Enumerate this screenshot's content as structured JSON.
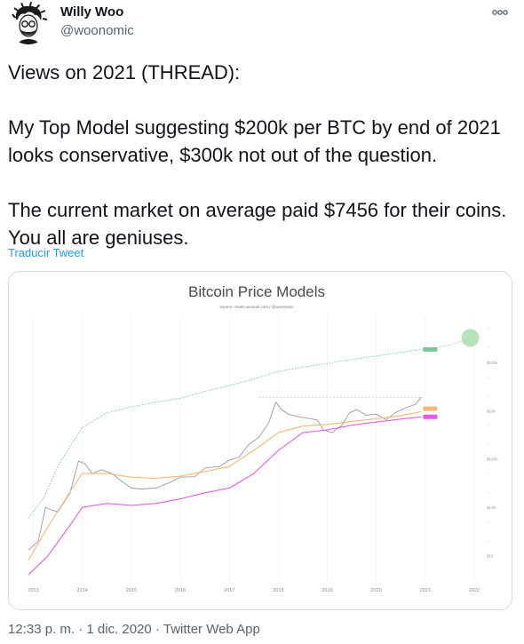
{
  "author": {
    "name": "Willy Woo",
    "handle": "@woonomic",
    "avatar_icon": "avatar-sketch"
  },
  "menu": {
    "more_icon": "more-dots-icon"
  },
  "tweet": {
    "paragraphs": [
      "Views on 2021 (THREAD):",
      "My Top Model suggesting $200k per BTC by end of 2021 looks conservative, $300k not out of the question.",
      "The current market on average paid $7456 for their coins. You all are geniuses."
    ],
    "translate_label": "Traducir Tweet"
  },
  "footer": {
    "time": "12:33 p. m.",
    "separator": "·",
    "date": "1 dic. 2020",
    "app": "Twitter Web App"
  },
  "colors": {
    "link": "#1d9bf0",
    "price": "#9a9a9a",
    "top_model": "#78c69a",
    "orange_model": "#f5b77a",
    "realized_price": "#e35ee8",
    "projection": "#9fd9a0"
  },
  "chart_data": {
    "type": "line",
    "title": "Bitcoin Price Models",
    "subtitle": "source: charts.woobull.com / @woonomic",
    "y_scale": "log",
    "x_ticks": [
      "2013",
      "2014",
      "2015",
      "2016",
      "2017",
      "2018",
      "2019",
      "2020",
      "2021",
      "2022"
    ],
    "y_ticks": [
      {
        "label": "$10",
        "value": 10
      },
      {
        "label": "$100",
        "value": 100
      },
      {
        "label": "$1000",
        "value": 1000
      },
      {
        "label": "$10k",
        "value": 10000
      },
      {
        "label": "$100k",
        "value": 100000
      }
    ],
    "xlim": [
      2012.9,
      2022.2
    ],
    "ylim": [
      3,
      900000
    ],
    "series": [
      {
        "key": "price",
        "x": [
          2012.9,
          2013.1,
          2013.25,
          2013.35,
          2013.5,
          2013.75,
          2013.92,
          2014.05,
          2014.2,
          2014.4,
          2014.6,
          2014.8,
          2015.0,
          2015.2,
          2015.5,
          2015.8,
          2016.0,
          2016.3,
          2016.5,
          2016.8,
          2017.0,
          2017.2,
          2017.4,
          2017.6,
          2017.8,
          2017.95,
          2018.05,
          2018.2,
          2018.4,
          2018.6,
          2018.8,
          2018.92,
          2019.1,
          2019.3,
          2019.45,
          2019.6,
          2019.8,
          2020.0,
          2020.2,
          2020.4,
          2020.6,
          2020.8,
          2020.92
        ],
        "values": [
          13,
          20,
          100,
          90,
          80,
          200,
          900,
          800,
          500,
          600,
          500,
          350,
          250,
          240,
          250,
          330,
          420,
          430,
          650,
          700,
          950,
          1100,
          2000,
          2800,
          5500,
          15000,
          11000,
          8500,
          7500,
          7000,
          6400,
          4000,
          3500,
          5000,
          9000,
          10500,
          8000,
          8500,
          6500,
          9200,
          11500,
          13500,
          19000
        ]
      },
      {
        "key": "top_model",
        "x": [
          2012.9,
          2013.2,
          2013.5,
          2013.8,
          2014.0,
          2014.5,
          2015.0,
          2015.5,
          2016.0,
          2016.5,
          2017.0,
          2017.5,
          2018.0,
          2018.5,
          2019.0,
          2019.5,
          2020.0,
          2020.5,
          2020.92
        ],
        "values": [
          60,
          150,
          700,
          2200,
          4500,
          9000,
          12000,
          15000,
          18000,
          25000,
          33000,
          45000,
          65000,
          80000,
          95000,
          115000,
          135000,
          160000,
          185000
        ]
      },
      {
        "key": "orange_model",
        "x": [
          2012.9,
          2013.3,
          2013.8,
          2014.0,
          2014.5,
          2015.0,
          2015.5,
          2016.0,
          2016.5,
          2017.0,
          2017.5,
          2018.0,
          2018.5,
          2019.0,
          2019.5,
          2020.0,
          2020.5,
          2020.92
        ],
        "values": [
          8,
          40,
          250,
          500,
          500,
          420,
          400,
          440,
          550,
          700,
          1500,
          3500,
          4800,
          5200,
          6000,
          6800,
          7900,
          9500
        ]
      },
      {
        "key": "realized_price",
        "x": [
          2012.9,
          2013.3,
          2013.8,
          2014.0,
          2014.5,
          2015.0,
          2015.5,
          2016.0,
          2016.5,
          2017.0,
          2017.5,
          2018.0,
          2018.5,
          2019.0,
          2019.5,
          2020.0,
          2020.5,
          2020.92
        ],
        "values": [
          4,
          10,
          50,
          100,
          120,
          110,
          120,
          150,
          200,
          250,
          500,
          1500,
          3500,
          4000,
          5000,
          5800,
          6700,
          7456
        ]
      },
      {
        "key": "projection",
        "x": [
          2020.92,
          2021.2,
          2021.5,
          2021.8,
          2021.92
        ],
        "values": [
          185000,
          200000,
          230000,
          280000,
          320000
        ]
      }
    ],
    "projection_target": {
      "x": 2021.92,
      "value": 320000
    },
    "reference_lines": [
      {
        "x_start": 2013.92,
        "x_end": 2014.05,
        "value": 900
      },
      {
        "x_start": 2017.6,
        "x_end": 2020.95,
        "value": 19000
      }
    ]
  }
}
